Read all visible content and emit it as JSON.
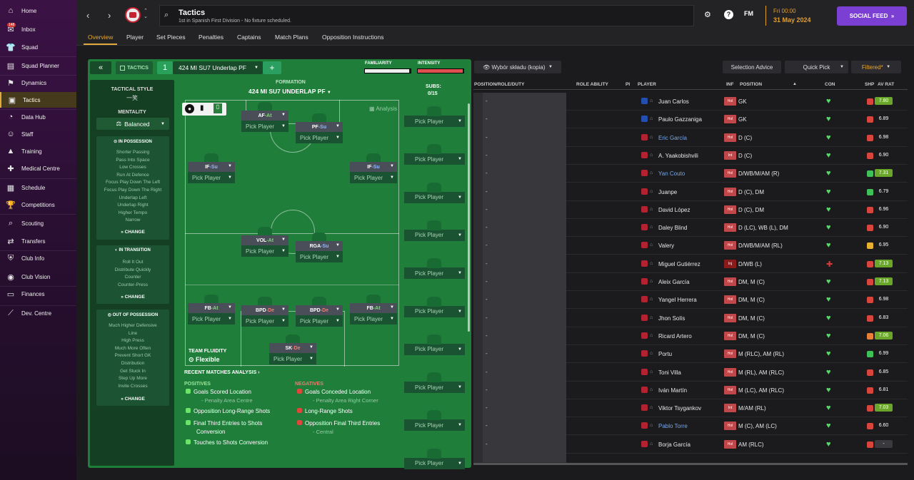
{
  "sidebar": {
    "items": [
      {
        "label": "Home",
        "icon": "home-icon",
        "glyph": "⌂"
      },
      {
        "label": "Inbox",
        "icon": "inbox-icon",
        "glyph": "✉",
        "badge": "148"
      },
      {
        "label": "Squad",
        "icon": "squad-icon",
        "glyph": "👕"
      },
      {
        "label": "Squad Planner",
        "icon": "squad-planner-icon",
        "glyph": "▤"
      },
      {
        "label": "Dynamics",
        "icon": "dynamics-icon",
        "glyph": "⚑"
      },
      {
        "label": "Tactics",
        "icon": "tactics-icon",
        "glyph": "▣",
        "active": true
      },
      {
        "label": "Data Hub",
        "icon": "data-hub-icon",
        "glyph": "◔"
      },
      {
        "label": "Staff",
        "icon": "staff-icon",
        "glyph": "☺"
      },
      {
        "label": "Training",
        "icon": "training-icon",
        "glyph": "▲"
      },
      {
        "label": "Medical Centre",
        "icon": "medical-centre-icon",
        "glyph": "✚"
      },
      {
        "label": "Schedule",
        "icon": "schedule-icon",
        "glyph": "▦"
      },
      {
        "label": "Competitions",
        "icon": "competitions-icon",
        "glyph": "🏆"
      },
      {
        "label": "Scouting",
        "icon": "scouting-icon",
        "glyph": "⌕"
      },
      {
        "label": "Transfers",
        "icon": "transfers-icon",
        "glyph": "⇄"
      },
      {
        "label": "Club Info",
        "icon": "club-info-icon",
        "glyph": "⛨"
      },
      {
        "label": "Club Vision",
        "icon": "club-vision-icon",
        "glyph": "◉"
      },
      {
        "label": "Finances",
        "icon": "finances-icon",
        "glyph": "▭"
      },
      {
        "label": "Dev. Centre",
        "icon": "dev-centre-icon",
        "glyph": "⟋"
      }
    ]
  },
  "header": {
    "title": "Tactics",
    "subtitle": "1st in Spanish First Division - No fixture scheduled.",
    "fm_label": "FM",
    "date_time": "Fri 00:00",
    "date": "31 May 2024",
    "social_feed": "SOCIAL FEED"
  },
  "tabs": [
    "Overview",
    "Player",
    "Set Pieces",
    "Penalties",
    "Captains",
    "Match Plans",
    "Opposition Instructions"
  ],
  "tactic": {
    "tactics_label": "TACTICS",
    "number": "1",
    "name": "424 MI SU7 Underlap PF",
    "familiarity_label": "FAMILIARITY",
    "intensity_label": "INTENSITY",
    "familiarity_value": 0.97,
    "intensity_value": 0.98,
    "formation_label": "FORMATION",
    "formation_name": "424 MI SU7 UNDERLAP PF",
    "subs_label": "SUBS:",
    "subs_value": "0/15",
    "analysis_label": "Analysis",
    "tactical_style_label": "TACTICAL STYLE",
    "tactical_style_value": "一笑",
    "mentality_label": "MENTALITY",
    "mentality_value": "Balanced",
    "in_possession_title": "IN POSSESSION",
    "in_possession": [
      "Shorter Passing",
      "Pass Into Space",
      "Low Crosses",
      "Run At Defence",
      "Focus Play Down The Left",
      "Focus Play Down The Right",
      "Underlap Left",
      "Underlap Right",
      "Higher Tempo",
      "Narrow"
    ],
    "in_transition_title": "IN TRANSITION",
    "in_transition": [
      "Roll It Out",
      "Distribute Quickly",
      "Counter",
      "Counter-Press"
    ],
    "out_possession_title": "OUT OF POSSESSION",
    "out_possession": [
      "Much Higher Defensive",
      "Line",
      "High Press",
      "Much More Often",
      "Prevent Short GK",
      "Distribution",
      "Get Stuck In",
      "Step Up More",
      "Invite Crosses"
    ],
    "change_label": "CHANGE",
    "team_fluidity_label": "TEAM FLUIDITY",
    "team_fluidity_value": "Flexible",
    "pick_label": "Pick Player"
  },
  "positions": [
    {
      "role": "AF",
      "duty": "At",
      "cls": "at"
    },
    {
      "role": "PF",
      "duty": "Su",
      "cls": "su"
    },
    {
      "role": "IF",
      "duty": "Su",
      "cls": "su"
    },
    {
      "role": "IF",
      "duty": "Su",
      "cls": "su"
    },
    {
      "role": "VOL",
      "duty": "At",
      "cls": "at"
    },
    {
      "role": "RGA",
      "duty": "Su",
      "cls": "su"
    },
    {
      "role": "FB",
      "duty": "At",
      "cls": "at"
    },
    {
      "role": "BPD",
      "duty": "De",
      "cls": "de"
    },
    {
      "role": "BPD",
      "duty": "De",
      "cls": "de"
    },
    {
      "role": "FB",
      "duty": "At",
      "cls": "at"
    },
    {
      "role": "SK",
      "duty": "De",
      "cls": "de"
    }
  ],
  "analysis": {
    "title": "RECENT MATCHES ANALYSIS ›",
    "positives_title": "POSITIVES",
    "negatives_title": "NEGATIVES",
    "positives": [
      {
        "text": "Goals Scored Location",
        "sub": "- Penalty Area Centre"
      },
      {
        "text": "Opposition Long-Range Shots",
        "sub": ""
      },
      {
        "text": "Final Third Entries to Shots",
        "sub": "Conversion"
      },
      {
        "text": "Touches to Shots Conversion",
        "sub": ""
      }
    ],
    "negatives": [
      {
        "text": "Goals Conceded Location",
        "sub": "- Penalty Area Right Corner"
      },
      {
        "text": "Long-Range Shots",
        "sub": ""
      },
      {
        "text": "Opposition Final Third Entries",
        "sub": "- Central"
      }
    ]
  },
  "right": {
    "squad_select": "Wybór składu (kopia)",
    "selection_advice": "Selection Advice",
    "quick_pick": "Quick Pick",
    "filtered": "Filtered*",
    "columns": [
      "POSITION/ROLE/DUTY",
      "ROLE ABILITY",
      "PI",
      "PLAYER",
      "INF",
      "POSITION",
      "CON",
      "SHP",
      "AV RAT"
    ],
    "dash": "-",
    "players": [
      {
        "name": "Juan Carlos",
        "pos": "GK",
        "inf": "Hol",
        "gk": true,
        "rat": "7.80",
        "ratc": "#6aa62a",
        "shp": "#d9453d",
        "blue": false,
        "con": "♥"
      },
      {
        "name": "Paulo Gazzaniga",
        "pos": "GK",
        "inf": "Hol",
        "gk": true,
        "rat": "6.89",
        "ratc": "",
        "shp": "#d9453d",
        "blue": false,
        "con": "♥"
      },
      {
        "name": "Eric García",
        "pos": "D (C)",
        "inf": "Hol",
        "gk": false,
        "rat": "6.98",
        "ratc": "",
        "shp": "#d9453d",
        "blue": true,
        "con": "♥"
      },
      {
        "name": "A. Yaakobishvili",
        "pos": "D (C)",
        "inf": "Int",
        "gk": false,
        "rat": "6.90",
        "ratc": "",
        "shp": "#d9453d",
        "blue": false,
        "con": "♥"
      },
      {
        "name": "Yan Couto",
        "pos": "D/WB/M/AM (R)",
        "inf": "Hol",
        "gk": false,
        "rat": "7.31",
        "ratc": "#6aa62a",
        "shp": "#3ec257",
        "blue": true,
        "con": "♥"
      },
      {
        "name": "Juanpe",
        "pos": "D (C), DM",
        "inf": "Hol",
        "gk": false,
        "rat": "6.79",
        "ratc": "",
        "shp": "#3ec257",
        "blue": false,
        "con": "♥"
      },
      {
        "name": "David López",
        "pos": "D (C), DM",
        "inf": "Hol",
        "gk": false,
        "rat": "6.96",
        "ratc": "",
        "shp": "#d9453d",
        "blue": false,
        "con": "♥"
      },
      {
        "name": "Daley Blind",
        "pos": "D (LC), WB (L), DM",
        "inf": "Hol",
        "gk": false,
        "rat": "6.90",
        "ratc": "",
        "shp": "#d9453d",
        "blue": false,
        "con": "♥"
      },
      {
        "name": "Valery",
        "pos": "D/WB/M/AM (RL)",
        "inf": "Hol",
        "gk": false,
        "rat": "6.95",
        "ratc": "",
        "shp": "#e8b02f",
        "blue": false,
        "con": "♥"
      },
      {
        "name": "Miguel Gutiérrez",
        "pos": "D/WB (L)",
        "inf": "Inj",
        "gk": false,
        "rat": "7.13",
        "ratc": "#6aa62a",
        "shp": "#d9453d",
        "blue": false,
        "con": "✚"
      },
      {
        "name": "Aleix García",
        "pos": "DM, M (C)",
        "inf": "Hol",
        "gk": false,
        "rat": "7.13",
        "ratc": "#6aa62a",
        "shp": "#d9453d",
        "blue": false,
        "con": "♥"
      },
      {
        "name": "Yangel Herrera",
        "pos": "DM, M (C)",
        "inf": "Hol",
        "gk": false,
        "rat": "6.98",
        "ratc": "",
        "shp": "#d9453d",
        "blue": false,
        "con": "♥"
      },
      {
        "name": "Jhon Solís",
        "pos": "DM, M (C)",
        "inf": "Hol",
        "gk": false,
        "rat": "6.83",
        "ratc": "",
        "shp": "#d9453d",
        "blue": false,
        "con": "♥"
      },
      {
        "name": "Ricard Artero",
        "pos": "DM, M (C)",
        "inf": "Hol",
        "gk": false,
        "rat": "7.06",
        "ratc": "#6aa62a",
        "shp": "#e8803a",
        "blue": false,
        "con": "♥"
      },
      {
        "name": "Portu",
        "pos": "M (RLC), AM (RL)",
        "inf": "Hol",
        "gk": false,
        "rat": "6.99",
        "ratc": "",
        "shp": "#3ec257",
        "blue": false,
        "con": "♥"
      },
      {
        "name": "Toni Villa",
        "pos": "M (RL), AM (RLC)",
        "inf": "Hol",
        "gk": false,
        "rat": "6.85",
        "ratc": "",
        "shp": "#d9453d",
        "blue": false,
        "con": "♥"
      },
      {
        "name": "Iván Martín",
        "pos": "M (LC), AM (RLC)",
        "inf": "Hol",
        "gk": false,
        "rat": "6.81",
        "ratc": "",
        "shp": "#d9453d",
        "blue": false,
        "con": "♥"
      },
      {
        "name": "Viktor Tsygankov",
        "pos": "M/AM (RL)",
        "inf": "Int",
        "gk": false,
        "rat": "7.03",
        "ratc": "#6aa62a",
        "shp": "#d9453d",
        "blue": false,
        "con": "♥"
      },
      {
        "name": "Pablo Torre",
        "pos": "M (C), AM (LC)",
        "inf": "Hol",
        "gk": false,
        "rat": "6.60",
        "ratc": "",
        "shp": "#d9453d",
        "blue": true,
        "con": "♥"
      },
      {
        "name": "Borja García",
        "pos": "AM (RLC)",
        "inf": "Hol",
        "gk": false,
        "rat": "-",
        "ratc": "#3a3a3e",
        "shp": "#d9453d",
        "blue": false,
        "con": "♥"
      }
    ]
  }
}
